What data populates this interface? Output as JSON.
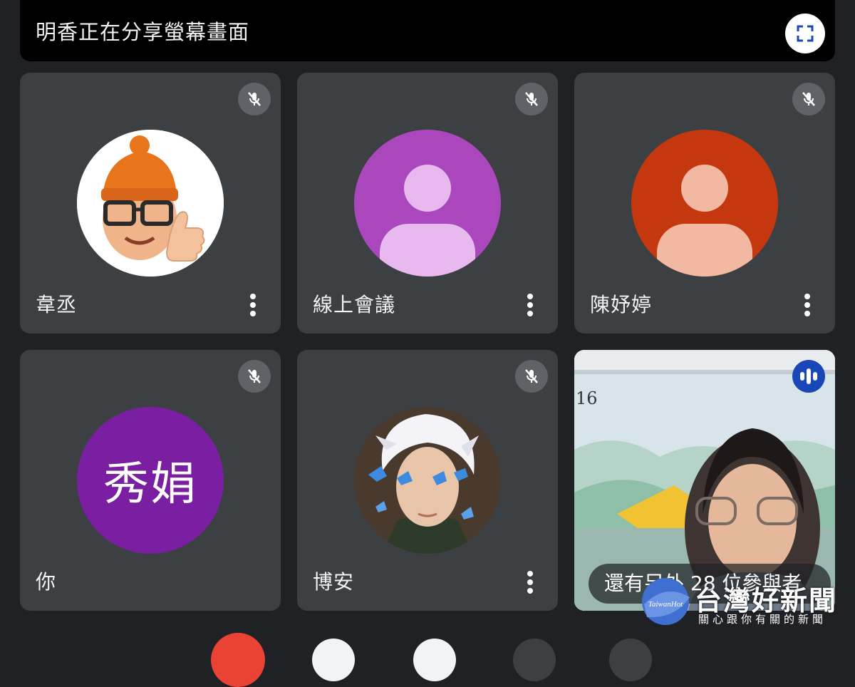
{
  "banner": {
    "text": "明香正在分享螢幕畫面",
    "fullscreen_icon": "fullscreen-icon"
  },
  "participants": [
    {
      "name": "韋丞",
      "muted": true,
      "avatar": "memoji-avatar"
    },
    {
      "name": "線上會議",
      "muted": true,
      "avatar": "default-person-avatar",
      "color": "#ab47bc"
    },
    {
      "name": "陳妤婷",
      "muted": true,
      "avatar": "default-person-avatar",
      "color": "#c5380f"
    },
    {
      "name": "你",
      "muted": true,
      "initials": "秀娟",
      "color": "#7b1fa2"
    },
    {
      "name": "博安",
      "muted": true,
      "avatar": "anime-avatar"
    }
  ],
  "video_tile": {
    "overlay": "還有另外 28 位參與者",
    "screen_text": "16",
    "speaking_icon": "speaking-indicator-icon"
  },
  "watermark": {
    "logo_text": "TaiwanHot",
    "title": "台灣好新聞",
    "subtitle": "關心跟你有關的新聞"
  },
  "colors": {
    "background": "#202124",
    "tile": "#3c4043",
    "accent": "#1a47b8"
  }
}
